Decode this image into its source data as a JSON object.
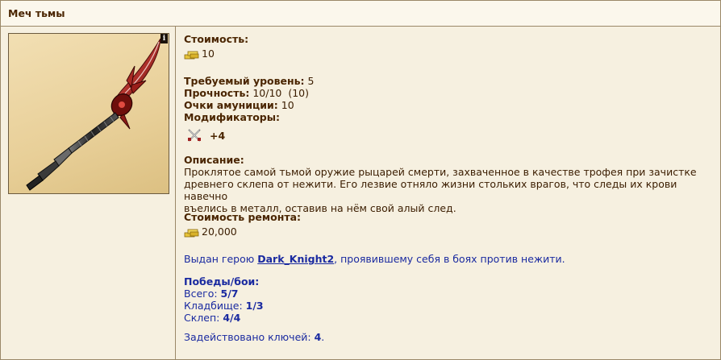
{
  "header": {
    "title": "Меч тьмы"
  },
  "item": {
    "cost_label": "Стоимость:",
    "cost_value": "10",
    "level_label": "Требуемый уровень:",
    "level_value": "5",
    "durability_label": "Прочность:",
    "durability_value": "10/10",
    "durability_extra": "(10)",
    "ammo_label": "Очки амуниции:",
    "ammo_value": "10",
    "mods_label": "Модификаторы:",
    "mod_value": "+4",
    "mod_icon": "crossed-swords-icon",
    "desc_label": "Описание:",
    "desc_line1": "Проклятое самой тьмой оружие рыцарей смерти, захваченное в качестве трофея при зачистке",
    "desc_line2": "древнего склепа от нежити. Его лезвие отняло жизни стольких врагов, что следы их крови навечно",
    "desc_line3": "въелись в металл, оставив на нём свой алый след.",
    "repair_label": "Стоимость ремонта:",
    "repair_value": "20,000"
  },
  "award": {
    "prefix": "Выдан герою ",
    "hero": "Dark_Knight2",
    "suffix": ", проявившему себя в боях против нежити."
  },
  "stats": {
    "title": "Победы/бои:",
    "total_label": "Всего: ",
    "total_value": "5/7",
    "cemetery_label": "Кладбище: ",
    "cemetery_value": "1/3",
    "crypt_label": "Склеп: ",
    "crypt_value": "4/4",
    "keys_label": "Задействовано ключей: ",
    "keys_value": "4",
    "keys_suffix": "."
  },
  "colors": {
    "background": "#f6f0e0",
    "border": "#9a8868",
    "label": "#4a2500",
    "link": "#1a2aa0"
  }
}
